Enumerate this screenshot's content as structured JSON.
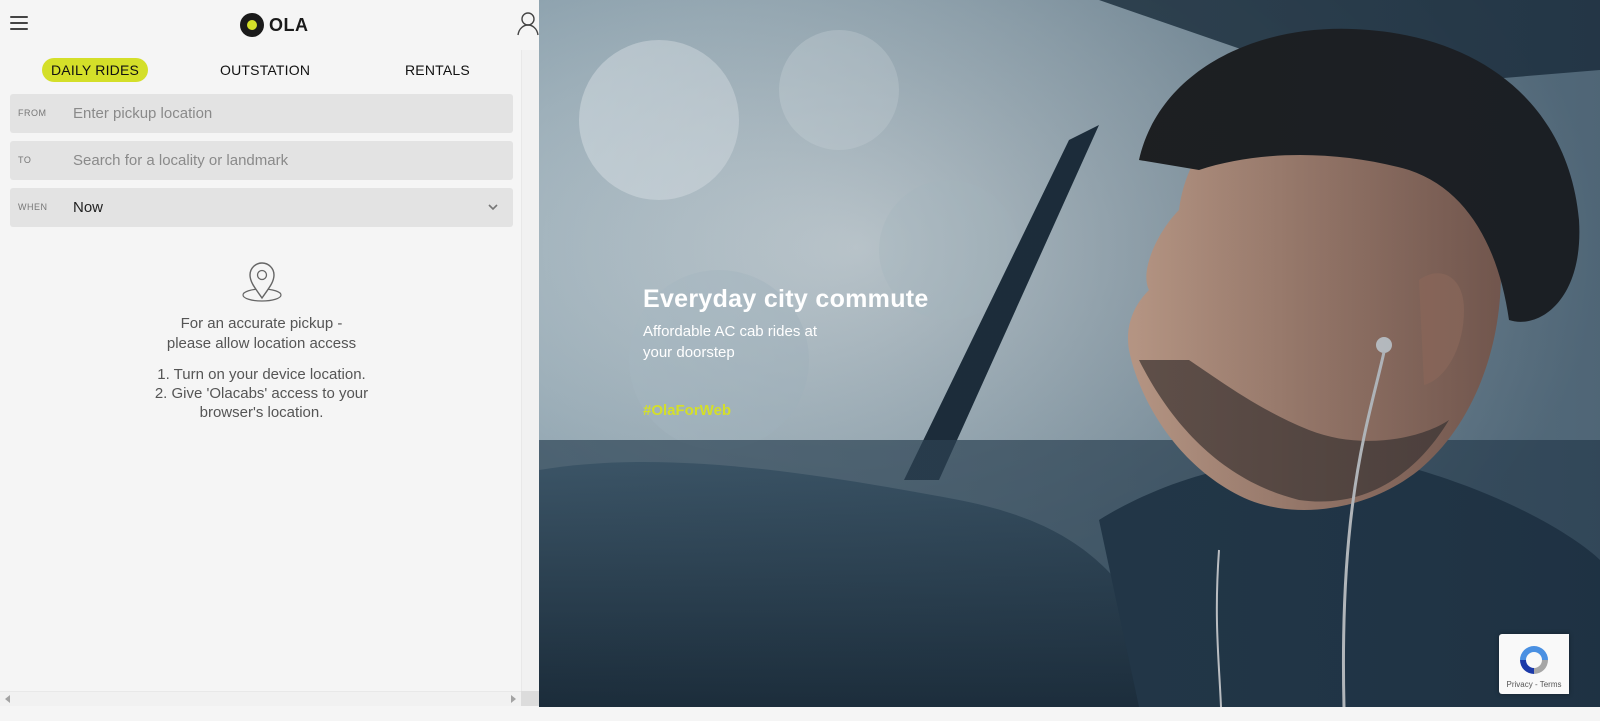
{
  "header": {
    "logo_text": "OLA",
    "menu_icon": "hamburger-menu-icon",
    "account_icon": "user-icon"
  },
  "tabs": [
    {
      "label": "DAILY RIDES",
      "active": true
    },
    {
      "label": "OUTSTATION",
      "active": false
    },
    {
      "label": "RENTALS",
      "active": false
    }
  ],
  "booking": {
    "from": {
      "label": "FROM",
      "placeholder": "Enter pickup location",
      "value": ""
    },
    "to": {
      "label": "TO",
      "placeholder": "Search for a locality or landmark",
      "value": ""
    },
    "when": {
      "label": "WHEN",
      "value": "Now"
    }
  },
  "location_prompt": {
    "icon": "location-pin-icon",
    "message_line1": "For an accurate pickup -",
    "message_line2": "please allow location access",
    "step1": "1. Turn on your device location.",
    "step2_line1": "2. Give 'Olacabs' access to your",
    "step2_line2": "browser's location."
  },
  "hero": {
    "title": "Everyday city commute",
    "subtitle_line1": "Affordable AC cab rides at",
    "subtitle_line2": "your doorstep",
    "hashtag": "#OlaForWeb"
  },
  "recaptcha": {
    "links": "Privacy - Terms"
  },
  "colors": {
    "brand_accent": "#d4df29",
    "field_bg": "#e3e3e3",
    "panel_bg": "#f5f5f5"
  }
}
